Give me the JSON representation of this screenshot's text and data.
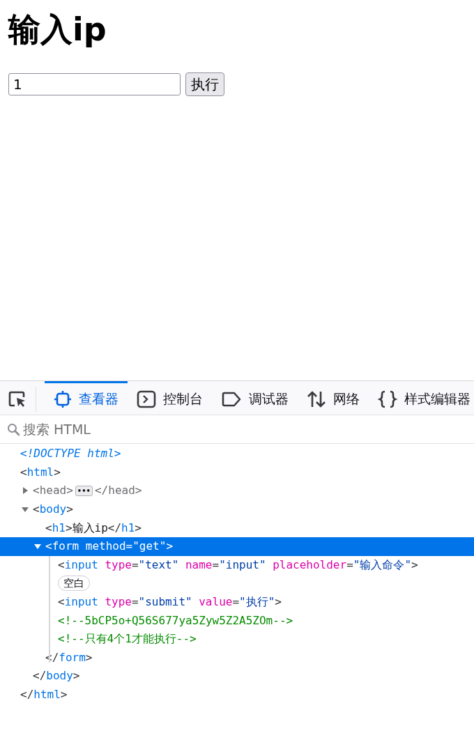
{
  "page": {
    "heading": "输入ip",
    "input": {
      "value": "1"
    },
    "button": "执行"
  },
  "devtools": {
    "tabs": [
      {
        "label": "查看器",
        "selected": true
      },
      {
        "label": "控制台",
        "selected": false
      },
      {
        "label": "调试器",
        "selected": false
      },
      {
        "label": "网络",
        "selected": false
      },
      {
        "label": "样式编辑器",
        "selected": false
      }
    ],
    "search": {
      "placeholder": "搜索 HTML"
    },
    "tree": [
      {
        "selected": false,
        "tokens": [
          {
            "kind": "doctype",
            "text": "<!DOCTYPE html>"
          }
        ]
      },
      {
        "selected": false,
        "tokens": [
          {
            "kind": "p",
            "text": "<"
          },
          {
            "kind": "tag",
            "text": "html"
          },
          {
            "kind": "p",
            "text": ">"
          }
        ],
        "close": [
          {
            "kind": "p",
            "text": "</"
          },
          {
            "kind": "tag",
            "text": "html"
          },
          {
            "kind": "p",
            "text": ">"
          }
        ],
        "children": [
          {
            "selected": false,
            "expanded": false,
            "tokens": [
              {
                "kind": "dim",
                "text": "<head>"
              },
              {
                "kind": "badge",
                "text": "•••"
              },
              {
                "kind": "dim",
                "text": "</head>"
              }
            ]
          },
          {
            "selected": false,
            "expanded": true,
            "tokens": [
              {
                "kind": "p",
                "text": "<"
              },
              {
                "kind": "tag",
                "text": "body"
              },
              {
                "kind": "p",
                "text": ">"
              }
            ],
            "close": [
              {
                "kind": "p",
                "text": "</"
              },
              {
                "kind": "tag",
                "text": "body"
              },
              {
                "kind": "p",
                "text": ">"
              }
            ],
            "children": [
              {
                "selected": false,
                "tokens": [
                  {
                    "kind": "p",
                    "text": "<"
                  },
                  {
                    "kind": "tag",
                    "text": "h1"
                  },
                  {
                    "kind": "p",
                    "text": ">"
                  },
                  {
                    "kind": "text",
                    "text": "输入ip"
                  },
                  {
                    "kind": "p",
                    "text": "</"
                  },
                  {
                    "kind": "tag",
                    "text": "h1"
                  },
                  {
                    "kind": "p",
                    "text": ">"
                  }
                ]
              },
              {
                "selected": true,
                "expanded": true,
                "tokens": [
                  {
                    "kind": "p",
                    "text": "<"
                  },
                  {
                    "kind": "tag",
                    "text": "form"
                  },
                  {
                    "kind": "attr",
                    "text": "method"
                  },
                  {
                    "kind": "p",
                    "text": "="
                  },
                  {
                    "kind": "val",
                    "text": "\"get\""
                  },
                  {
                    "kind": "p",
                    "text": ">"
                  }
                ],
                "close": [
                  {
                    "kind": "p",
                    "text": "</"
                  },
                  {
                    "kind": "tag",
                    "text": "form"
                  },
                  {
                    "kind": "p",
                    "text": ">"
                  }
                ],
                "children": [
                  {
                    "selected": false,
                    "tokens": [
                      {
                        "kind": "p",
                        "text": "<"
                      },
                      {
                        "kind": "tag",
                        "text": "input"
                      },
                      {
                        "kind": "attr",
                        "text": "type"
                      },
                      {
                        "kind": "p",
                        "text": "="
                      },
                      {
                        "kind": "val",
                        "text": "\"text\""
                      },
                      {
                        "kind": "attr",
                        "text": "name"
                      },
                      {
                        "kind": "p",
                        "text": "="
                      },
                      {
                        "kind": "val",
                        "text": "\"input\""
                      },
                      {
                        "kind": "attr",
                        "text": "placeholder"
                      },
                      {
                        "kind": "p",
                        "text": "="
                      },
                      {
                        "kind": "val",
                        "text": "\"输入命令\""
                      },
                      {
                        "kind": "p",
                        "text": ">"
                      }
                    ]
                  },
                  {
                    "selected": false,
                    "tokens": [
                      {
                        "kind": "pill",
                        "text": "空白"
                      }
                    ]
                  },
                  {
                    "selected": false,
                    "tokens": [
                      {
                        "kind": "p",
                        "text": "<"
                      },
                      {
                        "kind": "tag",
                        "text": "input"
                      },
                      {
                        "kind": "attr",
                        "text": "type"
                      },
                      {
                        "kind": "p",
                        "text": "="
                      },
                      {
                        "kind": "val",
                        "text": "\"submit\""
                      },
                      {
                        "kind": "attr",
                        "text": "value"
                      },
                      {
                        "kind": "p",
                        "text": "="
                      },
                      {
                        "kind": "val",
                        "text": "\"执行\""
                      },
                      {
                        "kind": "p",
                        "text": ">"
                      }
                    ]
                  },
                  {
                    "selected": false,
                    "tokens": [
                      {
                        "kind": "comment",
                        "text": "<!--5bCP5o+Q56S677ya5Zyw5Z2A5ZOm-->"
                      }
                    ]
                  },
                  {
                    "selected": false,
                    "tokens": [
                      {
                        "kind": "comment",
                        "text": "<!--只有4个1才能执行-->"
                      }
                    ]
                  }
                ]
              }
            ]
          }
        ]
      }
    ]
  }
}
